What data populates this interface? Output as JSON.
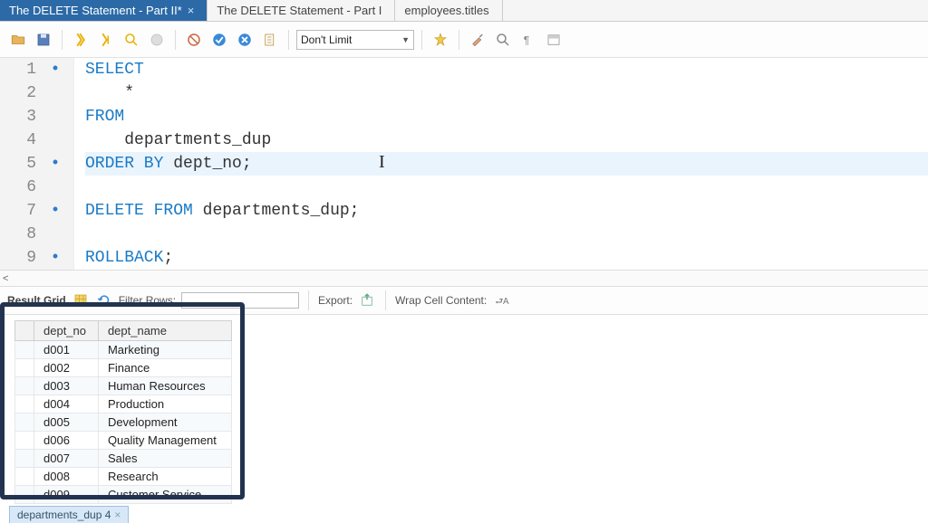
{
  "tabs": [
    {
      "label": "The DELETE Statement - Part II*",
      "active": true,
      "closable": true
    },
    {
      "label": "The DELETE Statement - Part I",
      "active": false,
      "closable": false
    },
    {
      "label": "employees.titles",
      "active": false,
      "closable": false
    }
  ],
  "toolbar": {
    "limit_label": "Don't Limit"
  },
  "editor": {
    "lines": [
      {
        "n": 1,
        "dot": true,
        "html": "<span class='kw'>SELECT</span>"
      },
      {
        "n": 2,
        "dot": false,
        "html": "    <span class='tx'>*</span>"
      },
      {
        "n": 3,
        "dot": false,
        "html": "<span class='kw'>FROM</span>"
      },
      {
        "n": 4,
        "dot": false,
        "html": "    <span class='tx'>departments_dup</span>"
      },
      {
        "n": 5,
        "dot": true,
        "html": "<span class='kw'>ORDER BY</span> <span class='tx'>dept_no;</span>",
        "hl": true
      },
      {
        "n": 6,
        "dot": false,
        "html": ""
      },
      {
        "n": 7,
        "dot": true,
        "html": "<span class='kw'>DELETE FROM</span> <span class='tx'>departments_dup;</span>"
      },
      {
        "n": 8,
        "dot": false,
        "html": ""
      },
      {
        "n": 9,
        "dot": true,
        "html": "<span class='kw'>ROLLBACK</span><span class='tx'>;</span>"
      }
    ]
  },
  "result_bar": {
    "grid_label": "Result Grid",
    "filter_label": "Filter Rows:",
    "export_label": "Export:",
    "wrap_label": "Wrap Cell Content:"
  },
  "grid": {
    "columns": [
      "dept_no",
      "dept_name"
    ],
    "rows": [
      [
        "d001",
        "Marketing"
      ],
      [
        "d002",
        "Finance"
      ],
      [
        "d003",
        "Human Resources"
      ],
      [
        "d004",
        "Production"
      ],
      [
        "d005",
        "Development"
      ],
      [
        "d006",
        "Quality Management"
      ],
      [
        "d007",
        "Sales"
      ],
      [
        "d008",
        "Research"
      ],
      [
        "d009",
        "Customer Service"
      ]
    ]
  },
  "bottom_tab": {
    "label": "departments_dup 4"
  }
}
